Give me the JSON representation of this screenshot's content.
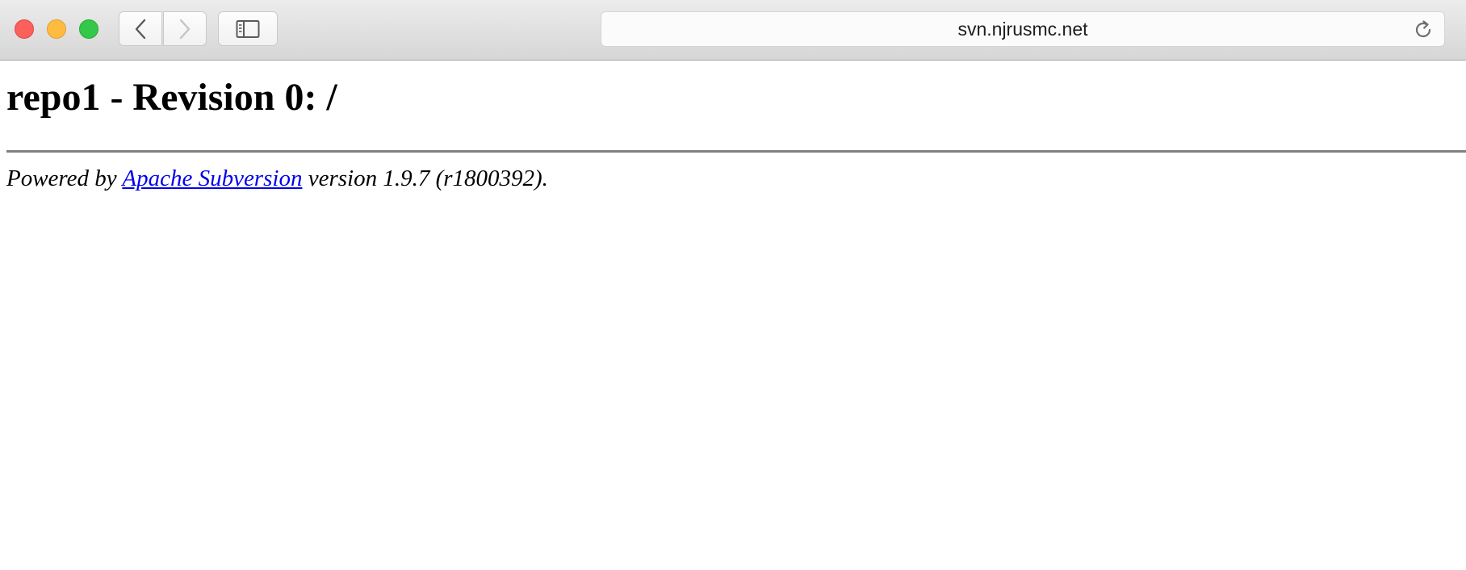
{
  "browser": {
    "address": "svn.njrusmc.net",
    "icons": {
      "back": "chevron-left-icon",
      "forward": "chevron-right-icon",
      "sidebar": "sidebar-icon",
      "reload": "reload-icon"
    },
    "colors": {
      "close": "#fc605c",
      "minimize": "#fdbc40",
      "zoom": "#34c84a"
    }
  },
  "page": {
    "title": "repo1 - Revision 0: /",
    "footer": {
      "prefix": "Powered by ",
      "link_text": "Apache Subversion",
      "suffix": " version 1.9.7 (r1800392)."
    },
    "colors": {
      "link": "#0000ee",
      "rule": "#808080"
    }
  }
}
